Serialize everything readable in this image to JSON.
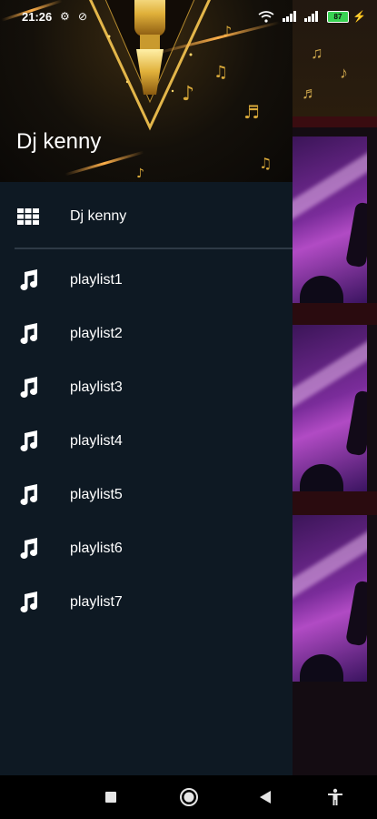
{
  "status_bar": {
    "time": "21:26",
    "battery": "87"
  },
  "drawer": {
    "header_title": "Dj kenny",
    "top_item": {
      "label": "Dj kenny",
      "icon": "grid-icon"
    },
    "items": [
      {
        "label": "playlist1",
        "icon": "music-note-icon"
      },
      {
        "label": "playlist2",
        "icon": "music-note-icon"
      },
      {
        "label": "playlist3",
        "icon": "music-note-icon"
      },
      {
        "label": "playlist4",
        "icon": "music-note-icon"
      },
      {
        "label": "playlist5",
        "icon": "music-note-icon"
      },
      {
        "label": "playlist6",
        "icon": "music-note-icon"
      },
      {
        "label": "playlist7",
        "icon": "music-note-icon"
      }
    ]
  },
  "nav_bar": {
    "buttons": [
      "recents-button",
      "home-button",
      "back-button",
      "accessibility-button"
    ]
  },
  "colors": {
    "drawer_bg": "#0e1923",
    "accent_gold": "#d9a93a",
    "battery_green": "#39d353"
  }
}
